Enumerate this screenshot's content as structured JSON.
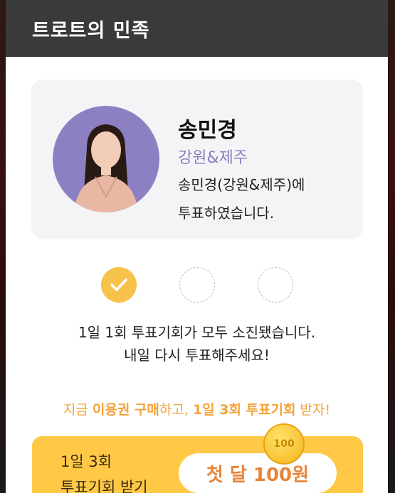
{
  "header": {
    "title": "트로트의 민족"
  },
  "candidate": {
    "name": "송민경",
    "region": "강원&제주",
    "message_line1": "송민경(강원&제주)에",
    "message_line2": "투표하였습니다."
  },
  "vote_slots": {
    "used": 1,
    "total": 3
  },
  "notice": {
    "line1": "1일 1회 투표기회가 모두 소진됐습니다.",
    "line2": "내일 다시 투표해주세요!"
  },
  "promo": {
    "p1": "지금 ",
    "b1": "이용권 구매",
    "p2": "하고, ",
    "b2": "1일 3회 투표기회",
    "p3": " 받자!"
  },
  "banner": {
    "line1": "1일 3회",
    "line2": "투표기회 받기",
    "button": "첫 달 100원",
    "coin": "100"
  },
  "colors": {
    "accent": "#f7c24a",
    "region": "#8b7fc0",
    "promo": "#f2a33a",
    "banner": "#ffc846",
    "header": "#3a3a3a"
  }
}
